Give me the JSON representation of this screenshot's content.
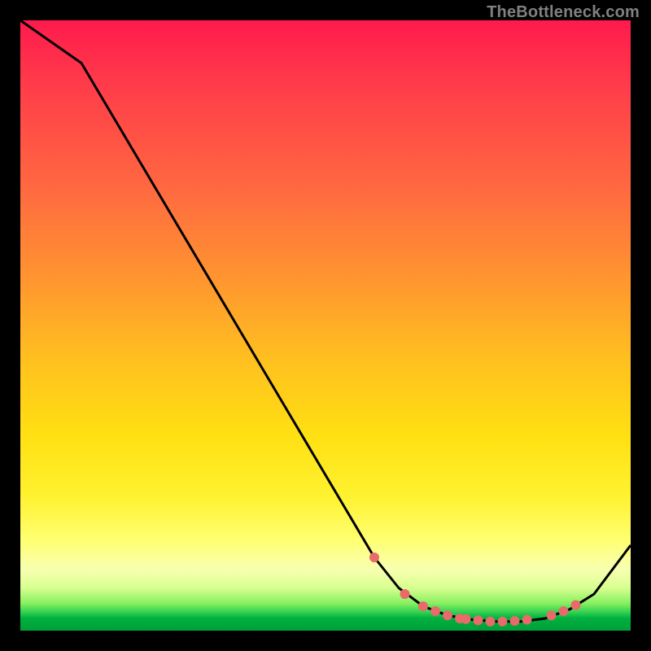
{
  "watermark": "TheBottleneck.com",
  "chart_data": {
    "type": "line",
    "title": "",
    "xlabel": "",
    "ylabel": "",
    "xlim": [
      0,
      100
    ],
    "ylim": [
      0,
      100
    ],
    "series": [
      {
        "name": "curve",
        "color": "#000000",
        "x": [
          0,
          10,
          58,
          62,
          66,
          70,
          74,
          78,
          82,
          86,
          90,
          94,
          100
        ],
        "values": [
          100,
          93,
          12,
          7,
          4,
          2.5,
          1.8,
          1.5,
          1.5,
          2,
          3.5,
          6,
          14
        ]
      }
    ],
    "markers": {
      "name": "highlight-points",
      "color": "#e86a6a",
      "x": [
        58,
        63,
        66,
        68,
        70,
        72,
        73,
        75,
        77,
        79,
        81,
        83,
        87,
        89,
        91
      ],
      "values": [
        12,
        6,
        4,
        3.2,
        2.5,
        2,
        1.9,
        1.7,
        1.5,
        1.5,
        1.6,
        1.8,
        2.5,
        3.2,
        4.2
      ]
    }
  }
}
